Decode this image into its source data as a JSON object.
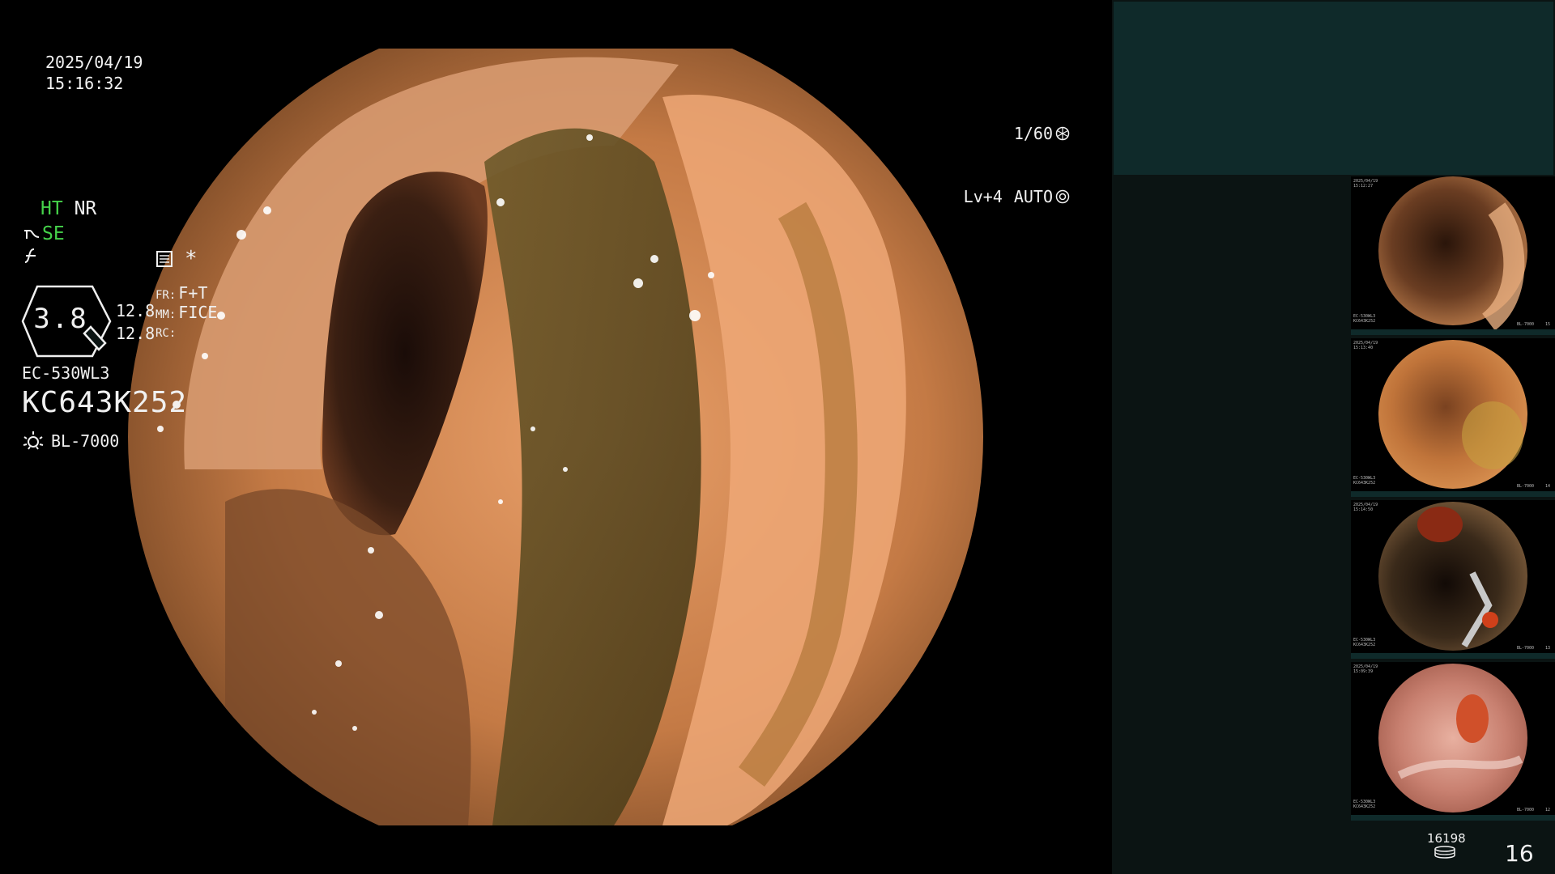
{
  "osd": {
    "date": "2025/04/19",
    "time": "15:16:32",
    "shutter": "1/60",
    "level": "Lv+4",
    "exposure_mode": "AUTO"
  },
  "status": {
    "ht": "HT",
    "nr": "NR",
    "se": "SE",
    "zoom": "3.8",
    "val_a": "12.8",
    "val_b": "12.8",
    "fr_label": "FR:",
    "fr_value": "F+T",
    "mm_label": "MM:",
    "mm_value": "FICE",
    "rc_label": "RC:",
    "rc_value": "",
    "asterisk": "*",
    "scope_model": "EC-530WL3",
    "scope_serial": "KC643K252",
    "light_source": "BL-7000"
  },
  "thumbnails": [
    {
      "caption_tl": "2025/04/19\n15:12:27",
      "caption_bl": "EC-530WL3\nKC643K252",
      "caption_br": "BL-7000",
      "index": "15"
    },
    {
      "caption_tl": "2025/04/19\n15:13:40",
      "caption_bl": "EC-530WL3\nKC643K252",
      "caption_br": "BL-7000",
      "index": "14"
    },
    {
      "caption_tl": "2025/04/19\n15:14:50",
      "caption_bl": "EC-530WL3\nKC643K252",
      "caption_br": "BL-7000",
      "index": "13"
    },
    {
      "caption_tl": "2025/04/19\n15:09:39",
      "caption_bl": "EC-530WL3\nKC643K252",
      "caption_br": "BL-7000",
      "index": "12"
    }
  ],
  "counter": {
    "storage_count": "16198",
    "image_count": "16"
  },
  "colors": {
    "panel_bg": "#0b1413",
    "panel_top": "#0f2a2a",
    "accent_green": "#45d24a"
  }
}
